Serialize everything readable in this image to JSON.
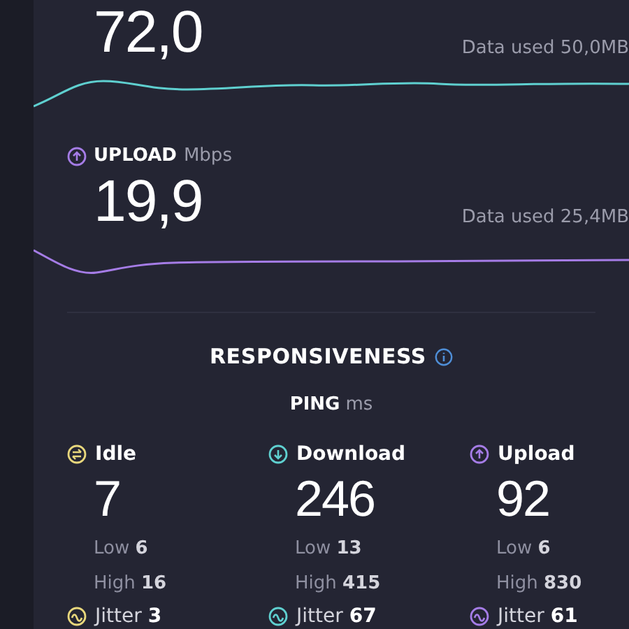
{
  "download": {
    "value": "72,0",
    "data_used": "Data used 50,0MB"
  },
  "upload": {
    "label": "UPLOAD",
    "unit": "Mbps",
    "value": "19,9",
    "data_used": "Data used 25,4MB"
  },
  "responsiveness": {
    "title": "RESPONSIVENESS",
    "ping_label": "PING",
    "ping_unit": "ms",
    "columns": [
      {
        "kind": "idle",
        "color": "#e8d77c",
        "label": "Idle",
        "value": "7",
        "low": "Low **6**",
        "high": "High **16**",
        "jitter": "Jitter **3**"
      },
      {
        "kind": "download",
        "color": "#5fd0d0",
        "label": "Download",
        "value": "246",
        "low": "Low **13**",
        "high": "High **415**",
        "jitter": "Jitter **67**"
      },
      {
        "kind": "upload",
        "color": "#a57ce6",
        "label": "Upload",
        "value": "92",
        "low": "Low **6**",
        "high": "High **830**",
        "jitter": "Jitter **61**"
      }
    ]
  }
}
